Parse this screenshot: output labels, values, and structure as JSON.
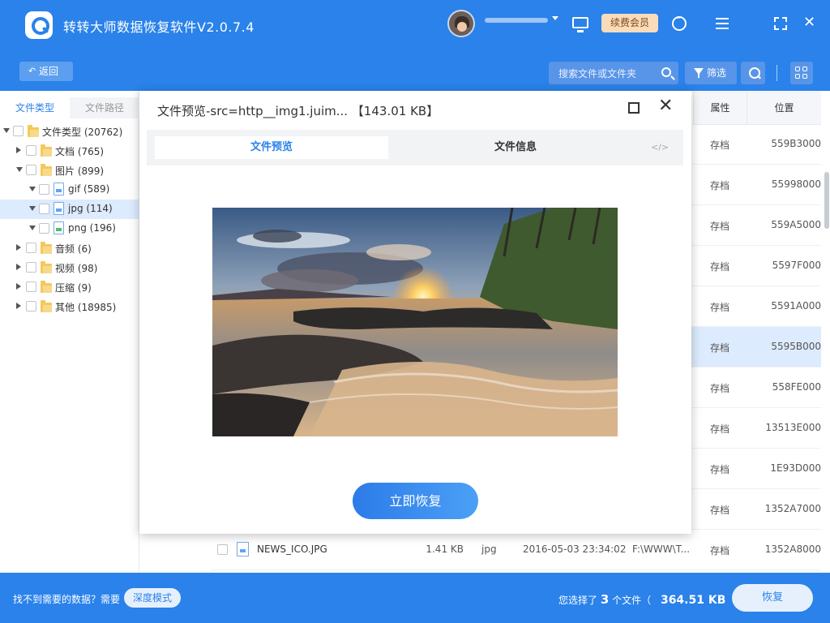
{
  "app": {
    "title": "转转大师数据恢复软件V2.0.7.4",
    "vip_label": "续费会员"
  },
  "toolbar": {
    "back_label": "返回",
    "search_placeholder": "搜索文件或文件夹",
    "filter_label": "筛选"
  },
  "sidebar": {
    "tabs": [
      "文件类型",
      "文件路径"
    ],
    "tree": [
      {
        "label": "文件类型 (20762)",
        "level": 0,
        "expanded": true,
        "icon": "folder-icon"
      },
      {
        "label": "文档 (765)",
        "level": 1,
        "expanded": false,
        "icon": "folder-icon"
      },
      {
        "label": "图片 (899)",
        "level": 1,
        "expanded": true,
        "icon": "folder-icon"
      },
      {
        "label": "gif (589)",
        "level": 2,
        "expanded": true,
        "icon": "image-file-icon"
      },
      {
        "label": "jpg (114)",
        "level": 2,
        "expanded": true,
        "icon": "image-file-icon",
        "selected": true
      },
      {
        "label": "png (196)",
        "level": 2,
        "expanded": true,
        "icon": "image-file-icon"
      },
      {
        "label": "音频 (6)",
        "level": 1,
        "expanded": false,
        "icon": "folder-icon"
      },
      {
        "label": "视频 (98)",
        "level": 1,
        "expanded": false,
        "icon": "folder-icon"
      },
      {
        "label": "压缩 (9)",
        "level": 1,
        "expanded": false,
        "icon": "folder-icon"
      },
      {
        "label": "其他 (18985)",
        "level": 1,
        "expanded": false,
        "icon": "folder-icon"
      }
    ]
  },
  "table": {
    "headers": {
      "attr": "属性",
      "pos": "位置"
    },
    "rows": [
      {
        "attr": "存档",
        "pos": "559B3000"
      },
      {
        "attr": "存档",
        "pos": "55998000"
      },
      {
        "attr": "存档",
        "pos": "559A5000"
      },
      {
        "attr": "存档",
        "pos": "5597F000"
      },
      {
        "attr": "存档",
        "pos": "5591A000"
      },
      {
        "attr": "存档",
        "pos": "5595B000",
        "selected": true
      },
      {
        "attr": "存档",
        "pos": "558FE000"
      },
      {
        "attr": "存档",
        "pos": "13513E000"
      },
      {
        "attr": "存档",
        "pos": "1E93D000"
      },
      {
        "attr": "存档",
        "pos": "1352A7000"
      },
      {
        "attr": "存档",
        "pos": "1352A8000",
        "name": "NEWS_ICO.JPG",
        "size": "1.41 KB",
        "type": "jpg",
        "date": "2016-05-03 23:34:02",
        "path": "F:\\WWW\\T..."
      }
    ]
  },
  "bottom": {
    "hint": "找不到需要的数据？需要",
    "deep_mode_label": "深度模式",
    "selected_prefix": "您选择了",
    "selected_count": "3",
    "selected_mid": "个文件（",
    "selected_size": "364.51 KB",
    "selected_suffix": "）",
    "recover_label": "恢复"
  },
  "modal": {
    "title": "文件预览-src=http__img1.juim... 【143.01 KB】",
    "tab_preview": "文件预览",
    "tab_info": "文件信息",
    "code_glyph": "</>",
    "recover_now_label": "立即恢复"
  }
}
